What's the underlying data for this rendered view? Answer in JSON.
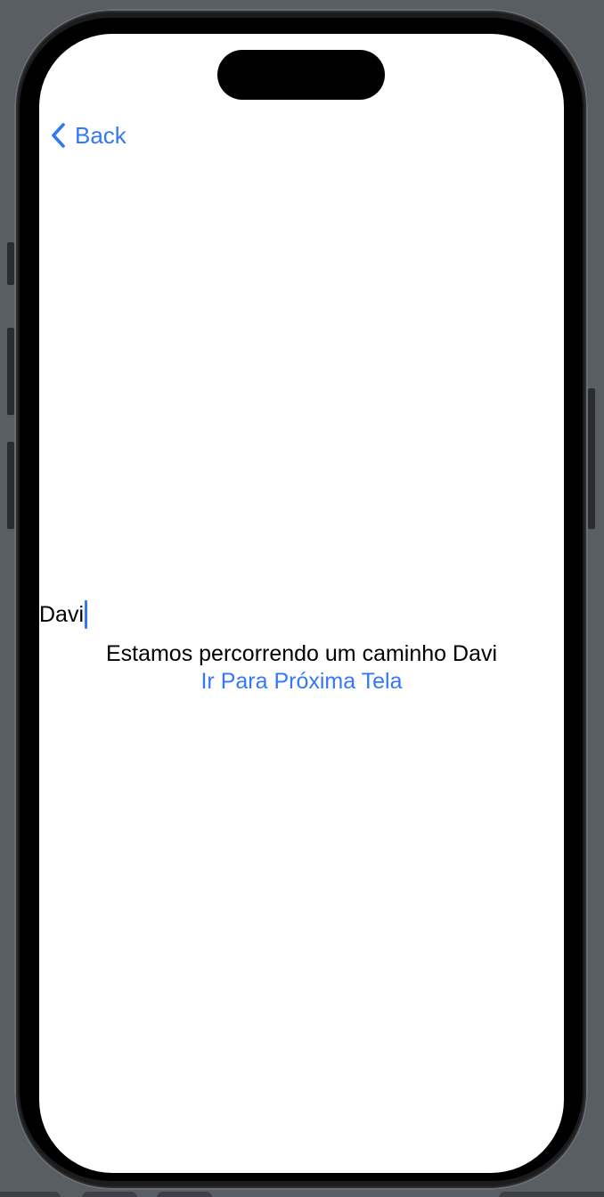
{
  "nav": {
    "back_label": "Back",
    "back_icon": "chevron-left-icon"
  },
  "form": {
    "name_value": "Davi"
  },
  "content": {
    "message": "Estamos percorrendo um caminho Davi",
    "next_link": "Ir Para Próxima Tela"
  },
  "colors": {
    "accent": "#3478f6",
    "background": "#ffffff",
    "desktop": "#595e63"
  }
}
